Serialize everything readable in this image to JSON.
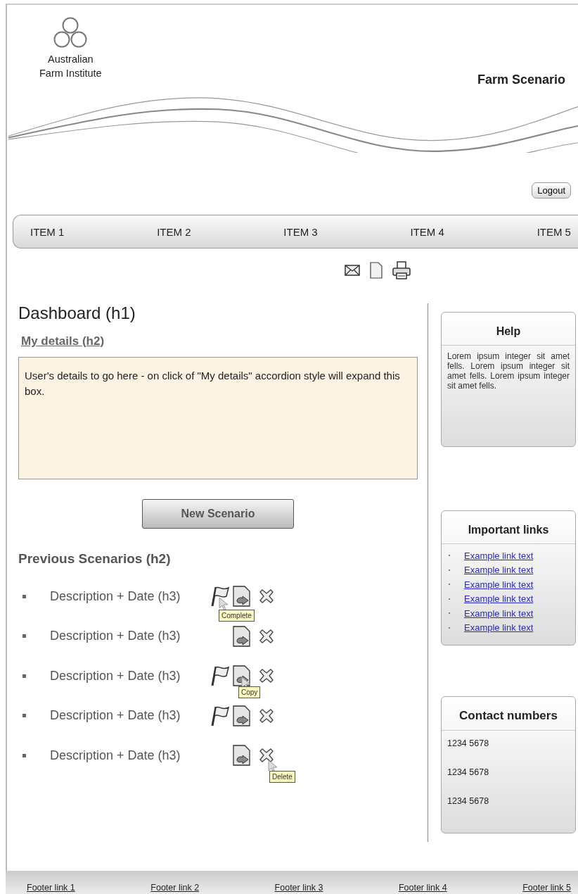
{
  "header": {
    "logo_text": [
      "Australian",
      "Farm Institute"
    ],
    "site_title": "Farm Scenario",
    "logout": "Logout"
  },
  "nav": [
    {
      "label": "ITEM 1"
    },
    {
      "label": "ITEM 2"
    },
    {
      "label": "ITEM 3"
    },
    {
      "label": "ITEM 4"
    },
    {
      "label": "ITEM 5"
    }
  ],
  "main": {
    "title": "Dashboard (h1)",
    "details_heading": "My details (h2)",
    "details_text": "User's details to go here - on click of \"My details\" accordion style will expand this box.",
    "new_button": "New Scenario",
    "previous_heading": "Previous Scenarios (h2)",
    "scenarios": [
      {
        "text": "Description + Date (h3)",
        "flagged": true,
        "flag_tooltip": "Complete"
      },
      {
        "text": "Description + Date (h3)",
        "flagged": false
      },
      {
        "text": "Description + Date (h3)",
        "flagged": true,
        "copy_tooltip": "Copy"
      },
      {
        "text": "Description + Date (h3)",
        "flagged": true
      },
      {
        "text": "Description + Date (h3)",
        "flagged": false,
        "delete_tooltip": "Delete"
      }
    ]
  },
  "sidebar": [
    {
      "kind": "text",
      "title": "Help",
      "text": "Lorem ipsum integer sit amet fells. Lorem ipsum integer sit amet fells. Lorem ipsum integer sit amet fells."
    },
    {
      "kind": "links",
      "title": "Important links",
      "items": [
        "Example link text",
        "Example link text",
        "Example link text",
        "Example link text",
        "Example link text",
        "Example link text"
      ]
    },
    {
      "kind": "numbers",
      "title": "Contact numbers",
      "items": [
        "1234 5678",
        "1234 5678",
        "1234 5678"
      ]
    }
  ],
  "footer": [
    "Footer link 1",
    "Footer link 2",
    "Footer link 3",
    "Footer link 4",
    "Footer link 5"
  ]
}
